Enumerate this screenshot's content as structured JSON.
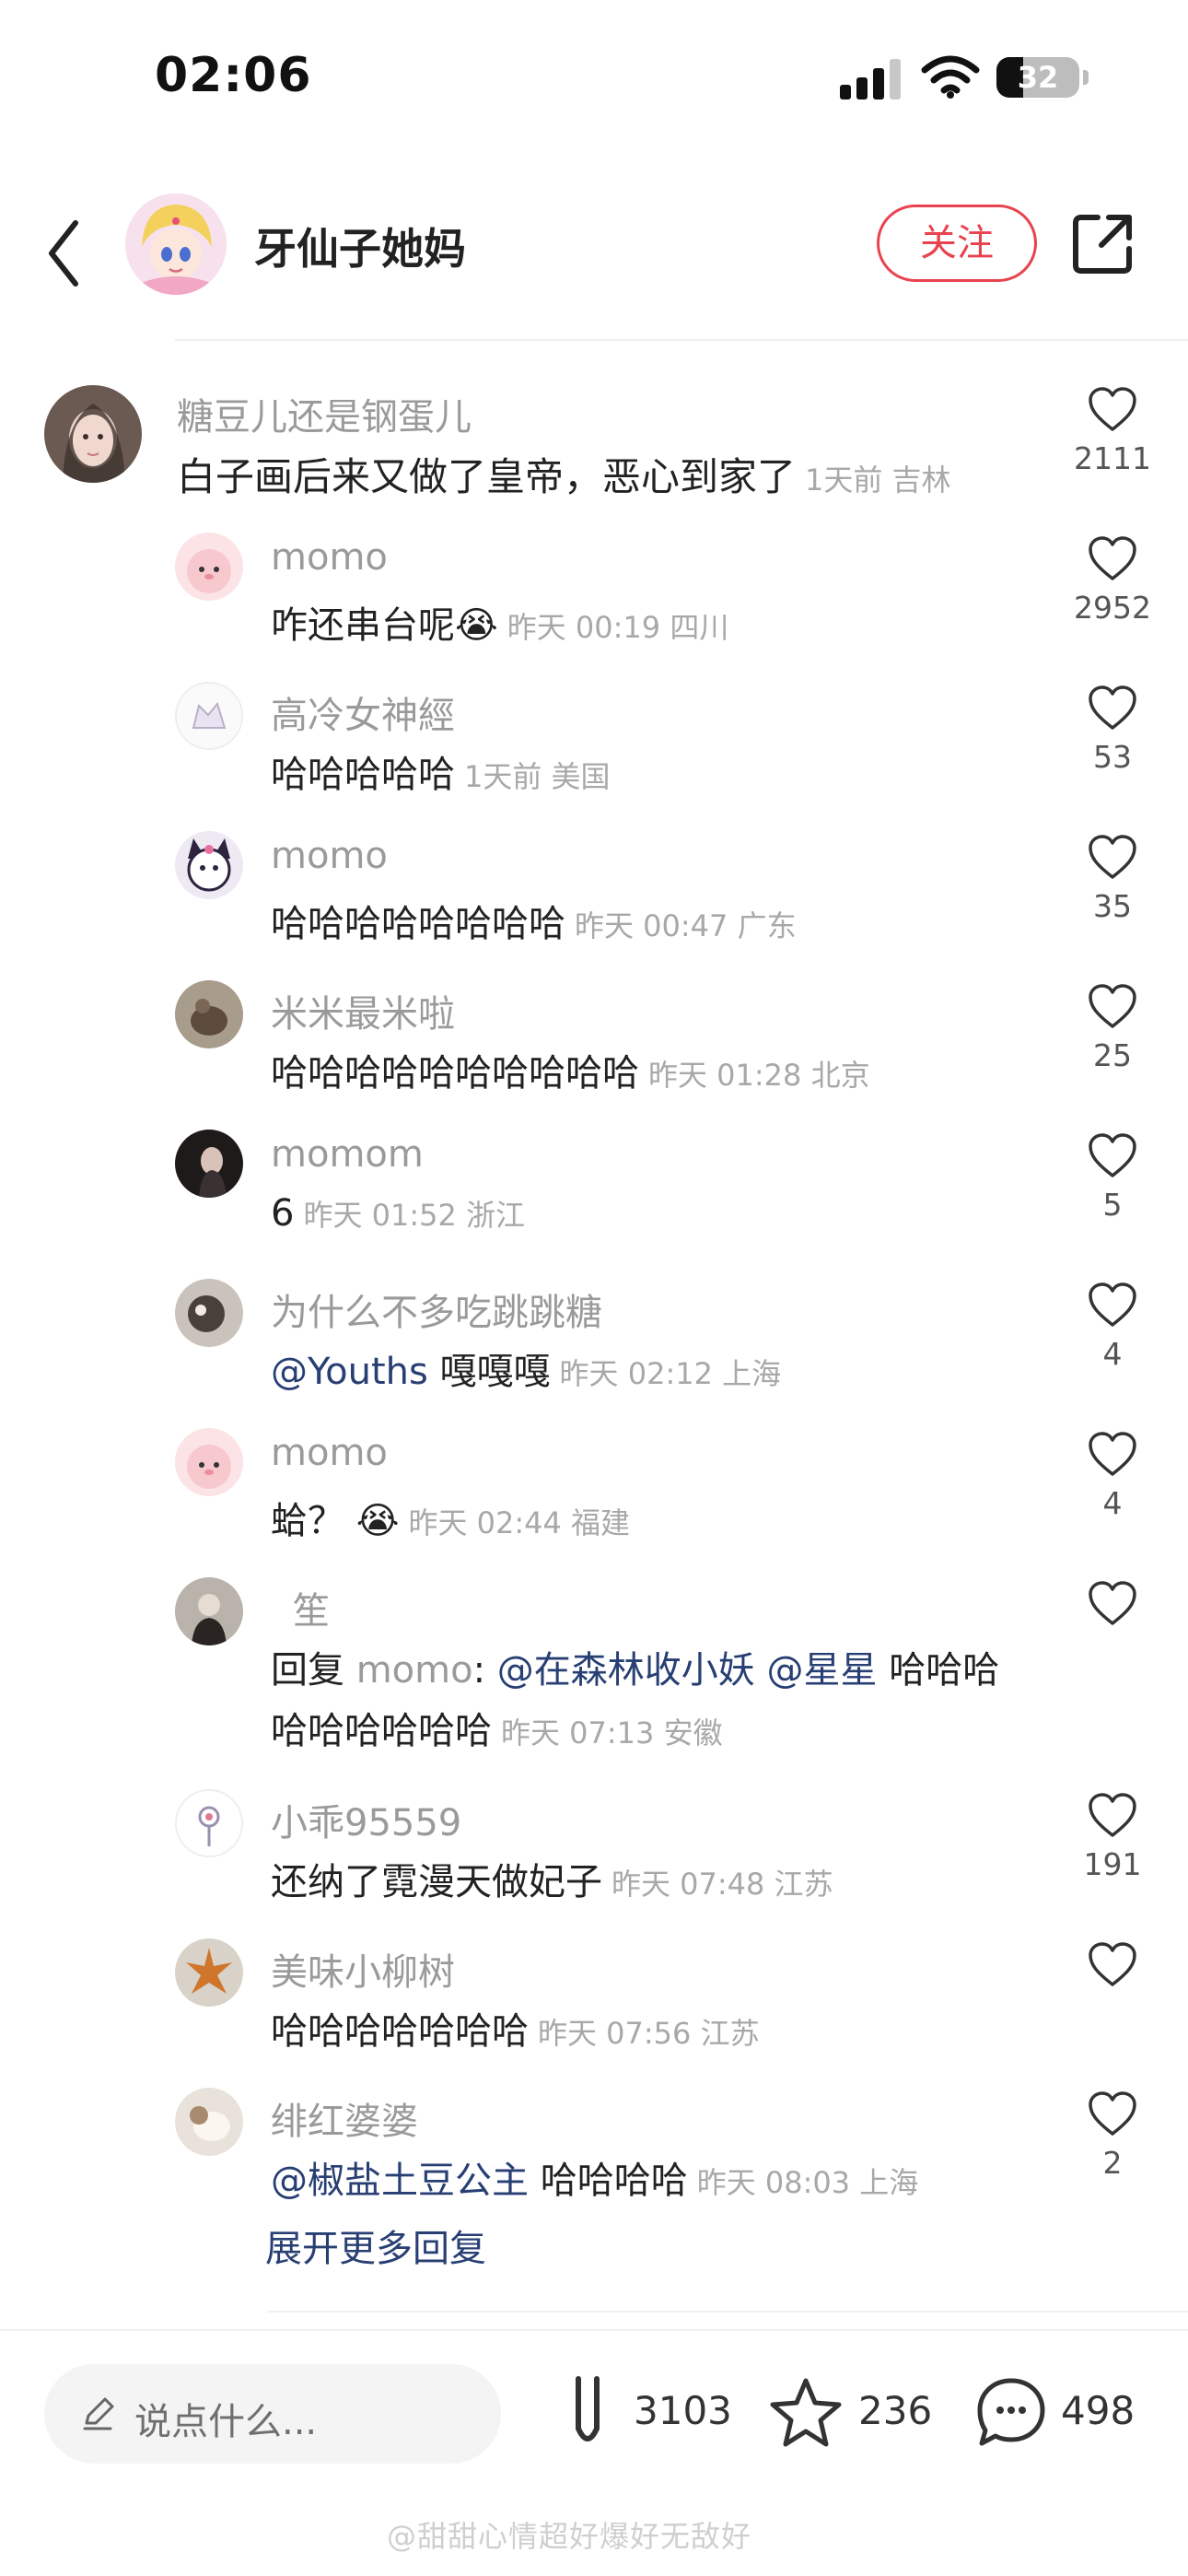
{
  "status_bar": {
    "time": "02:06",
    "battery": "32"
  },
  "header": {
    "author_name": "牙仙子她妈",
    "follow_label": "关注"
  },
  "main_comment": {
    "username": "糖豆儿还是钢蛋儿",
    "text": "白子画后来又做了皇帝，恶心到家了",
    "meta": "1天前 吉林",
    "likes": "2111"
  },
  "replies": [
    {
      "username": "momo",
      "text": "咋还串台呢",
      "emoji": "😭",
      "meta": "昨天 00:19 四川",
      "likes": "2952"
    },
    {
      "username": "高冷女神經",
      "text": "哈哈哈哈哈",
      "meta": "1天前 美国",
      "likes": "53"
    },
    {
      "username": "momo",
      "text": "哈哈哈哈哈哈哈哈",
      "meta": "昨天 00:47 广东",
      "likes": "35"
    },
    {
      "username": "米米最米啦",
      "text": "哈哈哈哈哈哈哈哈哈哈",
      "meta": "昨天 01:28 北京",
      "likes": "25"
    },
    {
      "username": "momom",
      "text": "6",
      "meta": "昨天 01:52 浙江",
      "likes": "5"
    },
    {
      "username": "为什么不多吃跳跳糖",
      "mention": "@Youths",
      "text": "嘎嘎嘎",
      "meta": "昨天 02:12 上海",
      "likes": "4"
    },
    {
      "username": "momo",
      "text": "蛤？",
      "emoji": "😭",
      "meta": "昨天 02:44 福建",
      "likes": "4"
    },
    {
      "username": "笙",
      "reply_prefix": "回复",
      "reply_target": "momo",
      "mention1": "@在森林收小妖",
      "mention2": "@星星",
      "text_line1_tail": "哈哈哈",
      "text_line2": "哈哈哈哈哈哈",
      "meta": "昨天 07:13 安徽",
      "likes": ""
    },
    {
      "username": "小乖95559",
      "text": "还纳了霓漫天做妃子",
      "meta": "昨天 07:48 江苏",
      "likes": "191"
    },
    {
      "username": "美味小柳树",
      "text": "哈哈哈哈哈哈哈",
      "meta": "昨天 07:56 江苏",
      "likes": ""
    },
    {
      "username": "绯红婆婆",
      "mention": "@椒盐土豆公主",
      "text": "哈哈哈哈",
      "meta": "昨天 08:03 上海",
      "likes": "2"
    }
  ],
  "more_replies_label": "展开更多回复",
  "bottom_bar": {
    "input_placeholder": "说点什么...",
    "like_count": "3103",
    "star_count": "236",
    "comment_count": "498"
  },
  "watermark": "@甜甜心情超好爆好无敌好",
  "colors": {
    "accent_red": "#e8434e",
    "mention_blue": "#283f73",
    "meta_gray": "#a8a8a8"
  }
}
